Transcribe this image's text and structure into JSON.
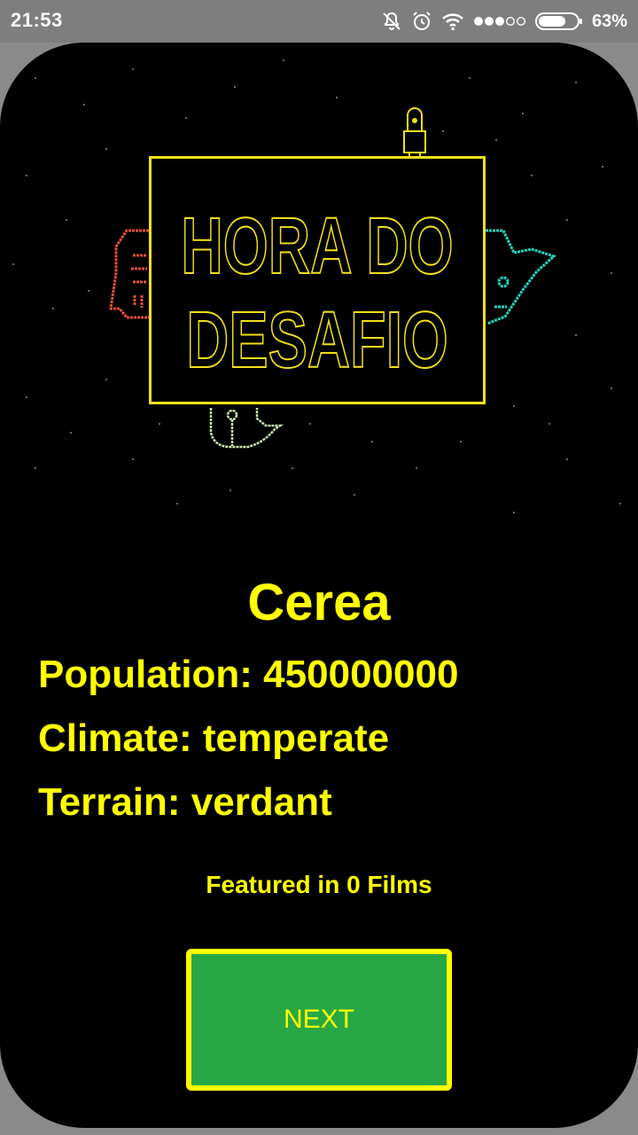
{
  "status_bar": {
    "time": "21:53",
    "battery_percent": "63%",
    "icons": [
      "notifications-off-icon",
      "alarm-icon",
      "wifi-icon",
      "signal-dots-icon",
      "battery-icon"
    ]
  },
  "logo": {
    "line1": "HORA DO",
    "line2": "DESAFIO"
  },
  "planet": {
    "name": "Cerea",
    "population": "Population: 450000000",
    "climate": "Climate: temperate",
    "terrain": "Terrain: verdant",
    "films": "Featured in 0 Films"
  },
  "actions": {
    "next_label": "NEXT"
  },
  "colors": {
    "text_accent": "#ffff00",
    "button_bg": "#27a845",
    "background": "#000000",
    "logo_border": "#f2e01a",
    "vader_red": "#e8513a",
    "yoda_teal": "#1fd6c0",
    "falcon_green": "#c9e8a8"
  }
}
